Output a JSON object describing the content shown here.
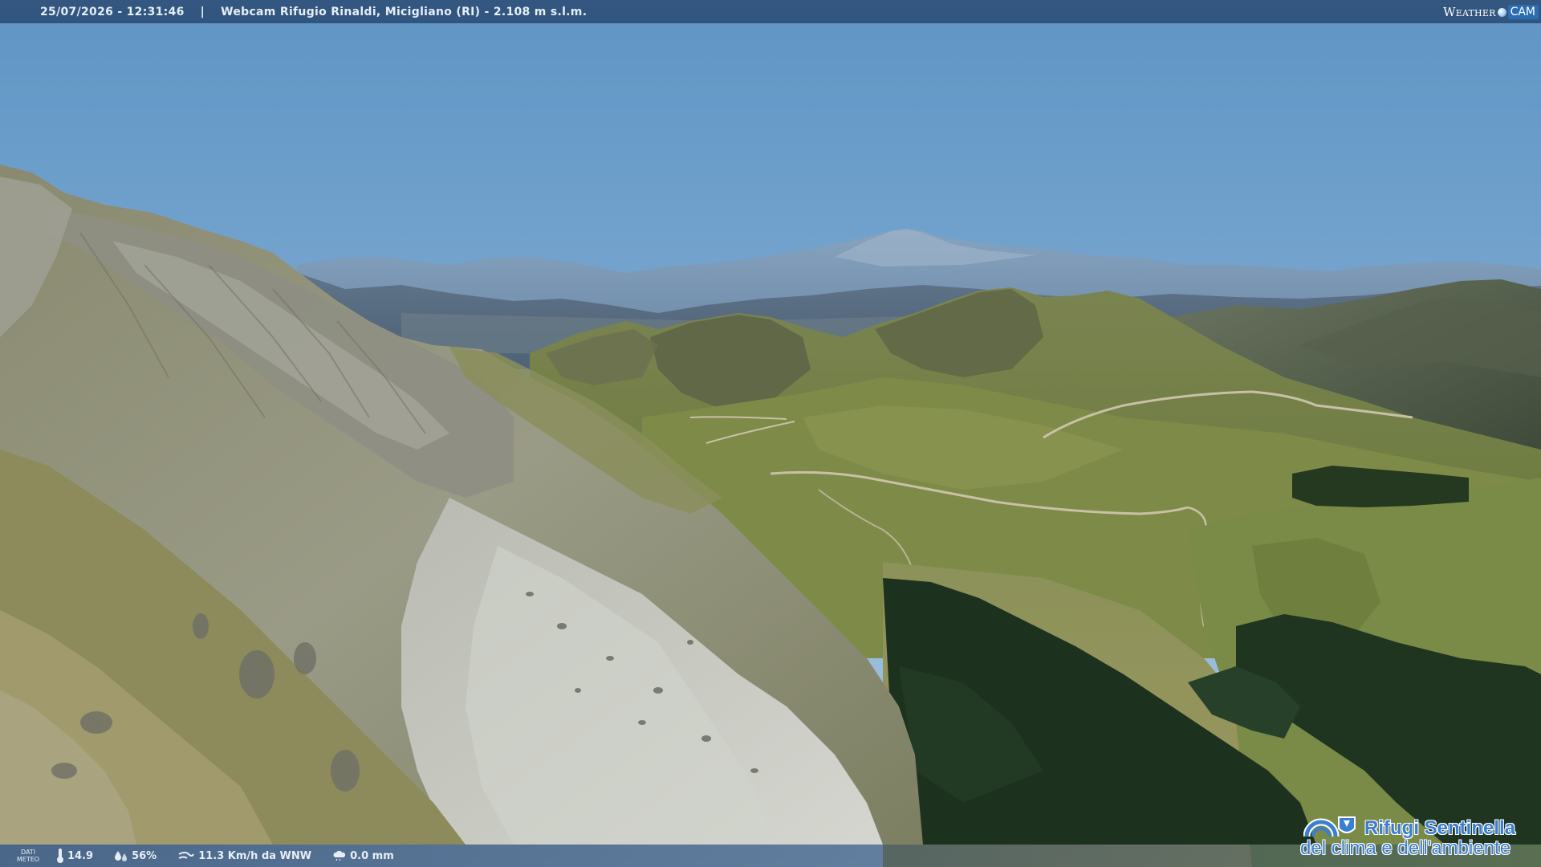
{
  "overlay_top": {
    "timestamp": "25/07/2026 - 12:31:46",
    "separator": "|",
    "title": "Webcam Rifugio Rinaldi, Micigliano (RI) - 2.108 m s.l.m."
  },
  "brand_logo": {
    "weather": "Weather",
    "cam": "CAM"
  },
  "overlay_bottom": {
    "label_line1": "DATI",
    "label_line2": "METEO",
    "temperature": "14.9",
    "humidity": "56%",
    "wind": "11.3 Km/h da WNW",
    "rain": "0.0 mm"
  },
  "partner_logo": {
    "line1": "Rifugi Sentinella",
    "line2": "del clima e dell'ambiente"
  },
  "colors": {
    "sky_top": "#6a9dc9",
    "sky_horizon": "#a9c7df",
    "distant_mountains": "#7d97b3",
    "mid_mountains": "#5e7288",
    "grass": "#7a8a4a",
    "rock": "#9e9e92",
    "scree": "#c9cbc3",
    "forest": "#1f3520",
    "logo_blue": "#3b7fd0"
  }
}
